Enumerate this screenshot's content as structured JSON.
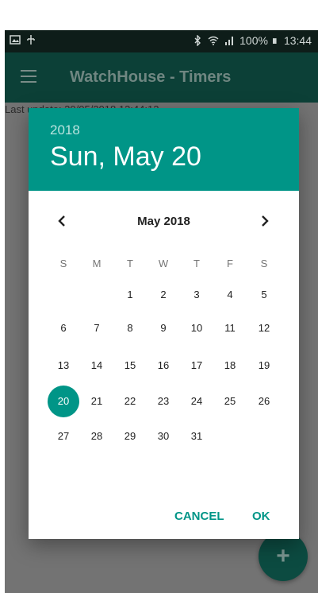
{
  "status_bar": {
    "battery": "100%",
    "time": "13:44"
  },
  "app_bar": {
    "title": "WatchHouse - Timers",
    "menu_icon": "hamburger-menu-icon"
  },
  "content": {
    "last_update": "Last update: 20/05/2018 13:44:12"
  },
  "fab": {
    "label": "+"
  },
  "date_picker": {
    "header_year": "2018",
    "header_date": "Sun, May 20",
    "month_label": "May 2018",
    "weekdays": [
      "S",
      "M",
      "T",
      "W",
      "T",
      "F",
      "S"
    ],
    "weeks": [
      [
        "",
        "",
        "1",
        "2",
        "3",
        "4",
        "5"
      ],
      [
        "6",
        "7",
        "8",
        "9",
        "10",
        "11",
        "12"
      ],
      [
        "13",
        "14",
        "15",
        "16",
        "17",
        "18",
        "19"
      ],
      [
        "20",
        "21",
        "22",
        "23",
        "24",
        "25",
        "26"
      ],
      [
        "27",
        "28",
        "29",
        "30",
        "31",
        "",
        ""
      ]
    ],
    "selected_day": "20",
    "cancel_label": "CANCEL",
    "ok_label": "OK",
    "accent_color": "#009587"
  }
}
